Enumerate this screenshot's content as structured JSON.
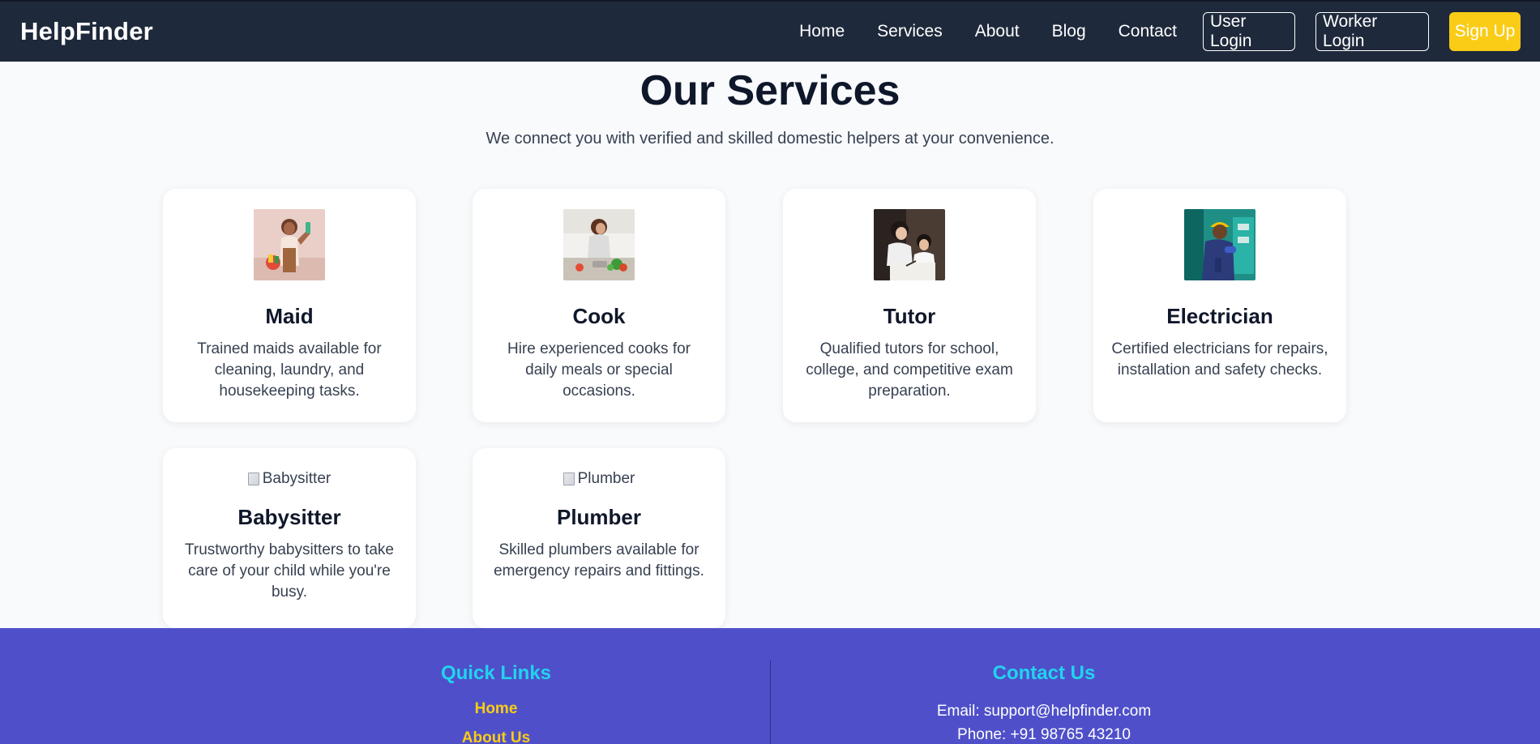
{
  "nav": {
    "brand": "HelpFinder",
    "links": [
      "Home",
      "Services",
      "About",
      "Blog",
      "Contact"
    ],
    "user_login": "User Login",
    "worker_login": "Worker Login",
    "signup": "Sign Up"
  },
  "header": {
    "title": "Our Services",
    "subtitle": "We connect you with verified and skilled domestic helpers at your convenience."
  },
  "services": [
    {
      "title": "Maid",
      "description": "Trained maids available for cleaning, laundry, and housekeeping tasks.",
      "image": "maid-photo"
    },
    {
      "title": "Cook",
      "description": "Hire experienced cooks for daily meals or special occasions.",
      "image": "cook-photo"
    },
    {
      "title": "Tutor",
      "description": "Qualified tutors for school, college, and competitive exam preparation.",
      "image": "tutor-photo"
    },
    {
      "title": "Electrician",
      "description": "Certified electricians for repairs, installation and safety checks.",
      "image": "electrician-photo"
    },
    {
      "title": "Babysitter",
      "description": "Trustworthy babysitters to take care of your child while you're busy.",
      "alt": "Babysitter"
    },
    {
      "title": "Plumber",
      "description": "Skilled plumbers available for emergency repairs and fittings.",
      "alt": "Plumber"
    }
  ],
  "footer": {
    "quick_links_heading": "Quick Links",
    "quick_links": [
      "Home",
      "About Us"
    ],
    "contact_heading": "Contact Us",
    "email": "Email: support@helpfinder.com",
    "phone": "Phone: +91 98765 43210"
  },
  "colors": {
    "nav_bg": "#1e293b",
    "signup_bg": "#facc15",
    "footer_bg": "#4f50c9",
    "footer_heading": "#22d3ee",
    "footer_link": "#facc15"
  }
}
